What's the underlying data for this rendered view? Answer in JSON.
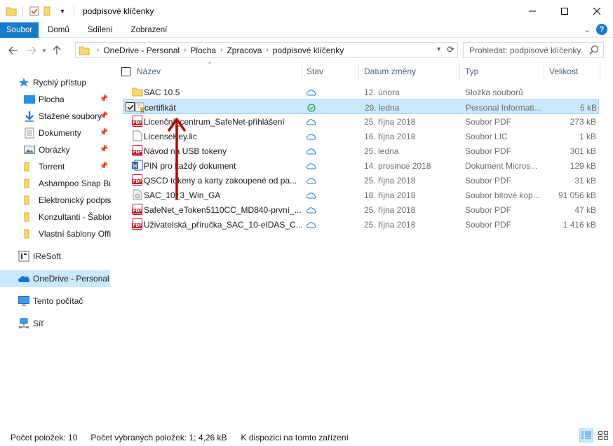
{
  "window": {
    "title": "podpisové klíčenky",
    "controls": [
      "minimize",
      "maximize",
      "close"
    ]
  },
  "ribbon": {
    "tabs": [
      "Soubor",
      "Domů",
      "Sdílení",
      "Zobrazení"
    ]
  },
  "address": {
    "crumbs": [
      "OneDrive - Personal",
      "Plocha",
      "Zpracova",
      "podpisové klíčenky"
    ],
    "search_placeholder": "Prohledat: podpisové klíčenky"
  },
  "sidebar": {
    "items": [
      {
        "label": "Rychlý přístup",
        "icon": "star-icon",
        "pinned": false
      },
      {
        "label": "Plocha",
        "icon": "desktop-icon",
        "pinned": true
      },
      {
        "label": "Stažené soubory",
        "icon": "download-icon",
        "pinned": true
      },
      {
        "label": "Dokumenty",
        "icon": "documents-icon",
        "pinned": true
      },
      {
        "label": "Obrázky",
        "icon": "pictures-icon",
        "pinned": true
      },
      {
        "label": "Torrent",
        "icon": "folder-icon",
        "pinned": true
      },
      {
        "label": "Ashampoo Snap Bu",
        "icon": "folder-icon",
        "pinned": false
      },
      {
        "label": "Elektronický podpis",
        "icon": "folder-icon",
        "pinned": false
      },
      {
        "label": "Konzultanti - Šablor",
        "icon": "folder-icon",
        "pinned": false
      },
      {
        "label": "Vlastní šablony Offi",
        "icon": "folder-icon",
        "pinned": false
      },
      {
        "label": "IReSoft",
        "icon": "app-icon",
        "pinned": false
      },
      {
        "label": "OneDrive - Personal",
        "icon": "onedrive-icon",
        "pinned": false
      },
      {
        "label": "Tento počítač",
        "icon": "computer-icon",
        "pinned": false
      },
      {
        "label": "Síť",
        "icon": "network-icon",
        "pinned": false
      }
    ]
  },
  "columns": {
    "name": "Název",
    "stav": "Stav",
    "date": "Datum změny",
    "type": "Typ",
    "size": "Velikost"
  },
  "files": [
    {
      "name": "SAC 10.5",
      "icon": "folder-icon",
      "status": "cloud",
      "date": "12. února",
      "type": "Složka souborů",
      "size": ""
    },
    {
      "name": "certifikát",
      "icon": "certificate-icon",
      "status": "synced",
      "date": "29. ledna",
      "type": "Personal Informati...",
      "size": "5 kB"
    },
    {
      "name": "Licenční_centrum_SafeNet-přihlášení",
      "icon": "pdf-icon",
      "status": "cloud",
      "date": "25. října 2018",
      "type": "Soubor PDF",
      "size": "273 kB"
    },
    {
      "name": "LicenseKey.lic",
      "icon": "file-icon",
      "status": "cloud",
      "date": "16. října 2018",
      "type": "Soubor LIC",
      "size": "1 kB"
    },
    {
      "name": "Návod na USB tokeny",
      "icon": "pdf-icon",
      "status": "cloud",
      "date": "25. ledna",
      "type": "Soubor PDF",
      "size": "301 kB"
    },
    {
      "name": "PIN pro každý dokument",
      "icon": "word-icon",
      "status": "cloud",
      "date": "14. prosince 2018",
      "type": "Dokument Micros...",
      "size": "129 kB"
    },
    {
      "name": "QSCD tokeny a karty zakoupené od pa...",
      "icon": "pdf-icon",
      "status": "cloud",
      "date": "25. října 2018",
      "type": "Soubor PDF",
      "size": "31 kB"
    },
    {
      "name": "SAC_10_3_Win_GA",
      "icon": "disk-image-icon",
      "status": "cloud",
      "date": "18. října 2018",
      "type": "Soubor bitové kop...",
      "size": "91 056 kB"
    },
    {
      "name": "SafeNet_eToken5110CC_MD840-první_...",
      "icon": "pdf-icon",
      "status": "cloud",
      "date": "25. října 2018",
      "type": "Soubor PDF",
      "size": "47 kB"
    },
    {
      "name": "Uživatelská_příručka_SAC_10-eIDAS_C...",
      "icon": "pdf-icon",
      "status": "cloud",
      "date": "25. října 2018",
      "type": "Soubor PDF",
      "size": "1 416 kB"
    }
  ],
  "status_bar": {
    "count": "Počet položek: 10",
    "selected": "Počet vybraných položek: 1; 4,26 kB",
    "availability": "K dispozici na tomto zařízení"
  },
  "colors": {
    "accent": "#1979ca",
    "selection": "#cce8ff",
    "annotation_arrow": "#c00000"
  }
}
